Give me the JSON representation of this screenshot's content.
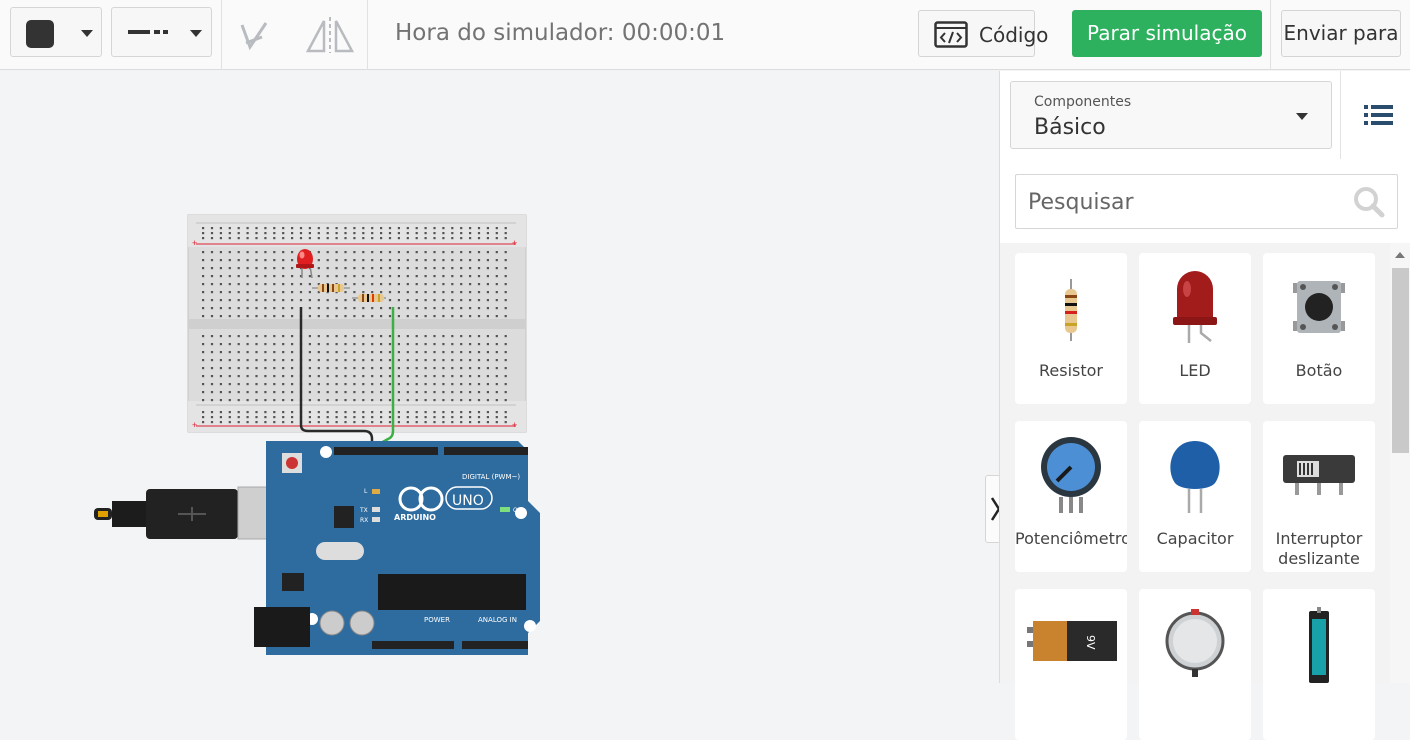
{
  "toolbar": {
    "fill_color": "#333333",
    "simulator_time_label": "Hora do simulador: 00:00:01",
    "code_label": "Código",
    "stop_label": "Parar simulação",
    "send_label": "Enviar para"
  },
  "panel": {
    "components_caption": "Componentes",
    "components_value": "Básico",
    "search_placeholder": "Pesquisar",
    "cards": [
      {
        "label": "Resistor",
        "icon": "resistor-icon"
      },
      {
        "label": "LED",
        "icon": "led-icon"
      },
      {
        "label": "Botão",
        "icon": "pushbutton-icon"
      },
      {
        "label": "Potenciômetro",
        "icon": "potentiometer-icon"
      },
      {
        "label": "Capacitor",
        "icon": "capacitor-icon"
      },
      {
        "label": "Interruptor\ndeslizante",
        "icon": "slide-switch-icon"
      },
      {
        "label": "",
        "icon": "battery-9v-icon"
      },
      {
        "label": "",
        "icon": "coin-battery-icon"
      },
      {
        "label": "",
        "icon": "aa-battery-icon"
      }
    ]
  },
  "board": {
    "digital_label": "DIGITAL (PWM~)",
    "brand": "ARDUINO",
    "model": "UNO",
    "power_label": "POWER",
    "analog_label": "ANALOG IN",
    "on_label": "ON",
    "tx_label": "TX",
    "rx_label": "RX",
    "l_label": "L",
    "battery_9v": "9V"
  },
  "colors": {
    "accent_green": "#2eb15f",
    "board_blue": "#2e6b9e",
    "wire_black": "#2a2a2a",
    "wire_green": "#3cb043",
    "led_red": "#e02020"
  }
}
